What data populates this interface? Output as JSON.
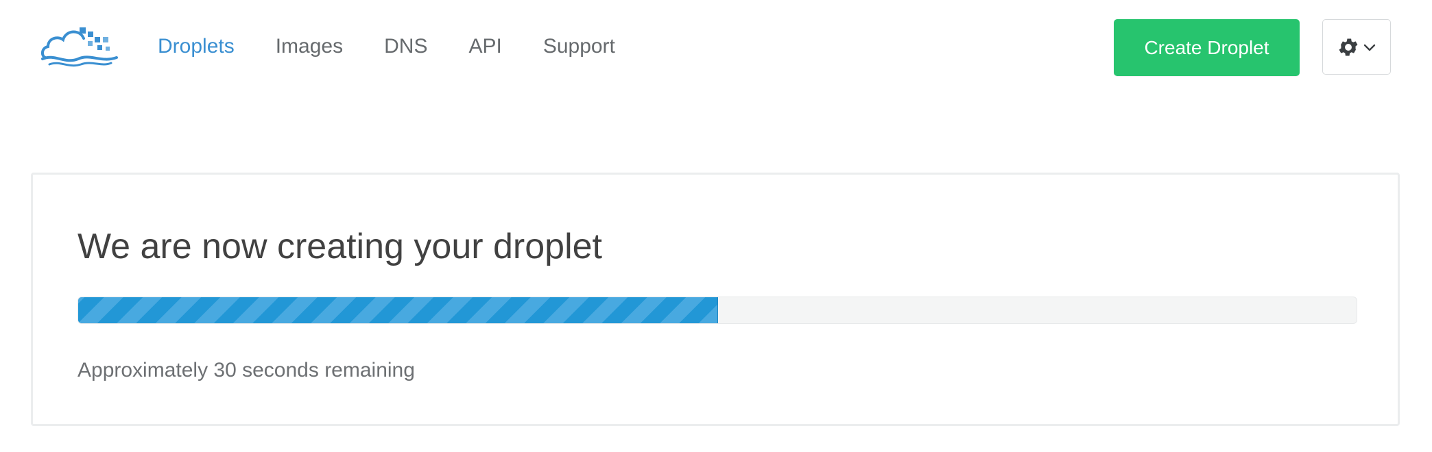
{
  "brand": {
    "logo_icon": "cloud-logo-icon",
    "colors": {
      "logo_blue": "#3a8fd1"
    }
  },
  "nav": {
    "items": [
      {
        "label": "Droplets",
        "active": true
      },
      {
        "label": "Images",
        "active": false
      },
      {
        "label": "DNS",
        "active": false
      },
      {
        "label": "API",
        "active": false
      },
      {
        "label": "Support",
        "active": false
      }
    ],
    "active_color": "#3a8fd1",
    "inactive_color": "#666a6d"
  },
  "actions": {
    "create_label": "Create Droplet",
    "create_color": "#27c46e",
    "settings_icon": "gear-icon",
    "settings_caret_icon": "chevron-down-icon"
  },
  "status_card": {
    "title": "We are now creating your droplet",
    "progress_fraction": 0.5,
    "progress_color": "#2a9ad8",
    "status_text": "Approximately 30 seconds remaining"
  }
}
